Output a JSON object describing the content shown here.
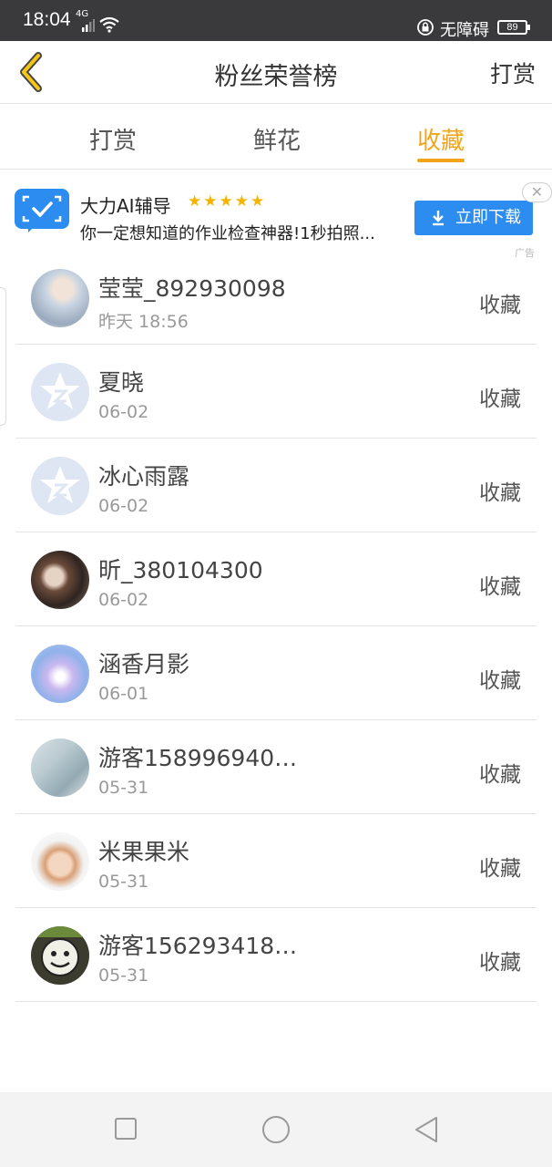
{
  "status_bar": {
    "time": "18:04",
    "network": "4G",
    "accessibility_label": "无障碍",
    "battery": "89"
  },
  "header": {
    "title": "粉丝荣誉榜",
    "right_action": "打赏"
  },
  "tabs": [
    {
      "label": "打赏",
      "active": false
    },
    {
      "label": "鲜花",
      "active": false
    },
    {
      "label": "收藏",
      "active": true
    }
  ],
  "ad": {
    "name": "大力AI辅导",
    "stars": "★★★★★",
    "description": "你一定想知道的作业检查神器!1秒拍照...",
    "download_label": "立即下载",
    "close": "✕",
    "ad_tag": "广告"
  },
  "list": [
    {
      "name": "莹莹_892930098",
      "date": "昨天 18:56",
      "action": "收藏"
    },
    {
      "name": "夏晓",
      "date": "06-02",
      "action": "收藏"
    },
    {
      "name": "冰心雨露",
      "date": "06-02",
      "action": "收藏"
    },
    {
      "name": "昕_380104300",
      "date": "06-02",
      "action": "收藏"
    },
    {
      "name": "涵香月影",
      "date": "06-01",
      "action": "收藏"
    },
    {
      "name": "游客1589969403...",
      "date": "05-31",
      "action": "收藏"
    },
    {
      "name": "米果果米",
      "date": "05-31",
      "action": "收藏"
    },
    {
      "name": "游客1562934185...",
      "date": "05-31",
      "action": "收藏"
    }
  ],
  "colors": {
    "accent": "#f2a51b",
    "ad_blue": "#2d8cf0",
    "status_bar": "#3a3a3c"
  }
}
